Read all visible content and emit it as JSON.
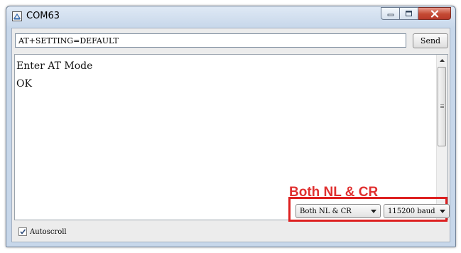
{
  "window": {
    "title": "COM63",
    "icons": {
      "app": "serial-monitor-icon",
      "minimize": "minimize-icon",
      "maximize": "maximize-icon",
      "close": "close-icon"
    }
  },
  "input": {
    "value": "AT+SETTING=DEFAULT",
    "send_label": "Send"
  },
  "output": {
    "lines": "Enter AT Mode\nOK"
  },
  "annotation": {
    "text": "Both NL & CR",
    "color": "#e03030"
  },
  "footer": {
    "autoscroll_label": "Autoscroll",
    "autoscroll_checked": true,
    "line_ending": "Both NL & CR",
    "baud_rate": "115200 baud"
  },
  "colors": {
    "highlight": "#dd2020",
    "close_button": "#c44a33"
  }
}
